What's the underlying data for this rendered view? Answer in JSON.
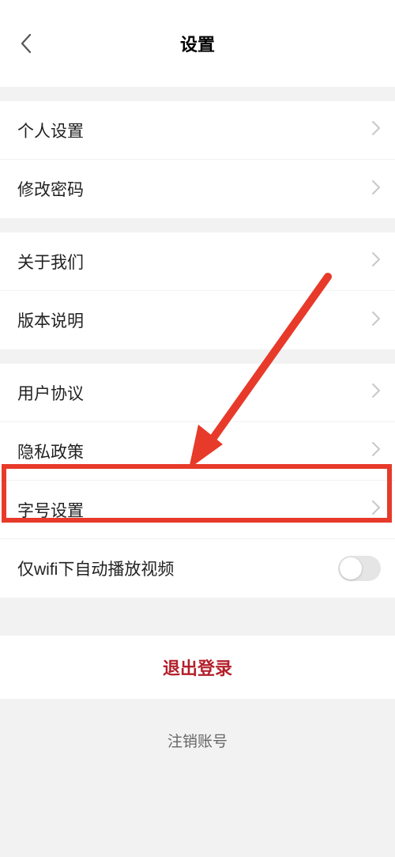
{
  "header": {
    "title": "设置"
  },
  "sections": {
    "personal": "个人设置",
    "password": "修改密码",
    "about": "关于我们",
    "version": "版本说明",
    "agreement": "用户协议",
    "privacy": "隐私政策",
    "fontsize": "字号设置",
    "wifi": "仅wifi下自动播放视频"
  },
  "actions": {
    "logout": "退出登录",
    "delete": "注销账号"
  },
  "toggle": {
    "wifi_on": false
  },
  "annotation": {
    "highlight_target": "fontsize",
    "colors": {
      "highlight": "#e73a2a",
      "logout": "#b31f2a"
    }
  }
}
